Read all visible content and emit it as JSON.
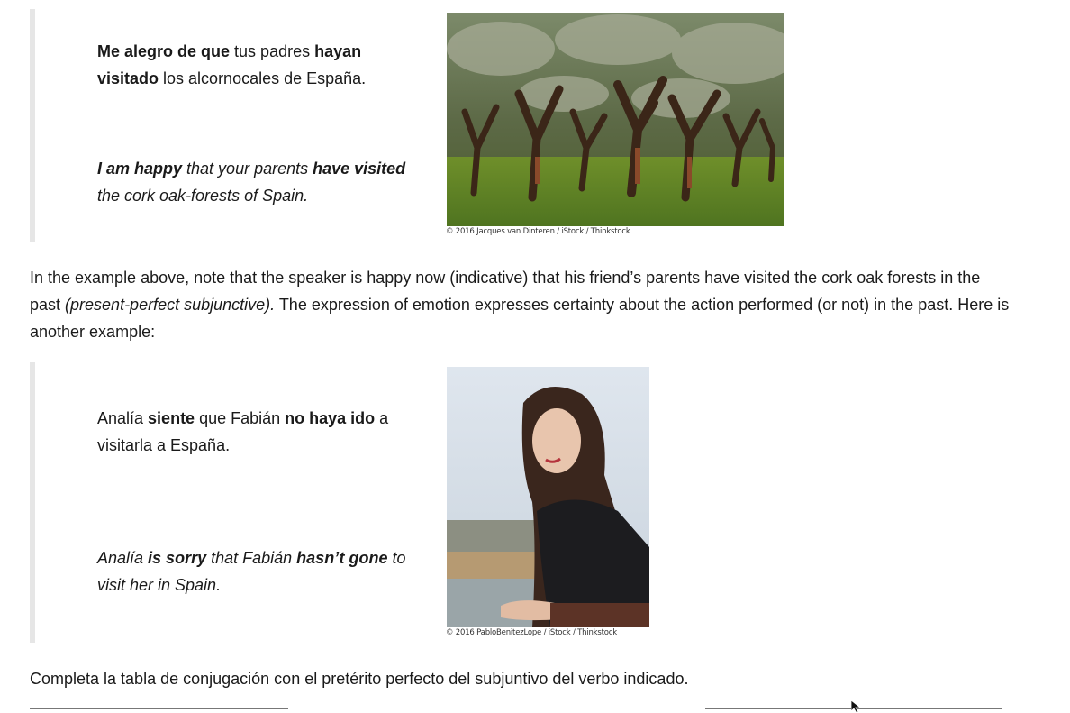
{
  "example1": {
    "es_pre1": "Me alegro de que",
    "es_mid1": " tus padres ",
    "es_bold2": "hayan visitado",
    "es_rest": " los alcornocales de España.",
    "en_b1": "I am happy",
    "en_mid": " that your parents ",
    "en_b2": "have visited",
    "en_rest": " the cork oak-forests of Spain.",
    "credit": "© 2016 Jacques van Dinteren / iStock / Thinkstock"
  },
  "paragraph1": {
    "text_a": "In the example above, note that the speaker is happy now (indicative) that his friend’s parents have visited the cork oak forests in the past ",
    "text_em": "(present-perfect subjunctive).",
    "text_b": " The expression of emotion expresses certainty about the action performed (or not) in the past. Here is another example:"
  },
  "example2": {
    "es_a": "Analía ",
    "es_b1": "siente",
    "es_c": " que Fabián ",
    "es_b2": "no haya ido",
    "es_d": " a visitarla a España.",
    "en_a": "Analía ",
    "en_b1": "is sorry",
    "en_c": " that Fabián ",
    "en_b2": "hasn’t gone",
    "en_d": " to visit her in Spain.",
    "credit": "© 2016 PabloBenitezLope / iStock / Thinkstock"
  },
  "instruction": "Completa la tabla de conjugación con el pretérito perfecto del subjuntivo del verbo indicado."
}
